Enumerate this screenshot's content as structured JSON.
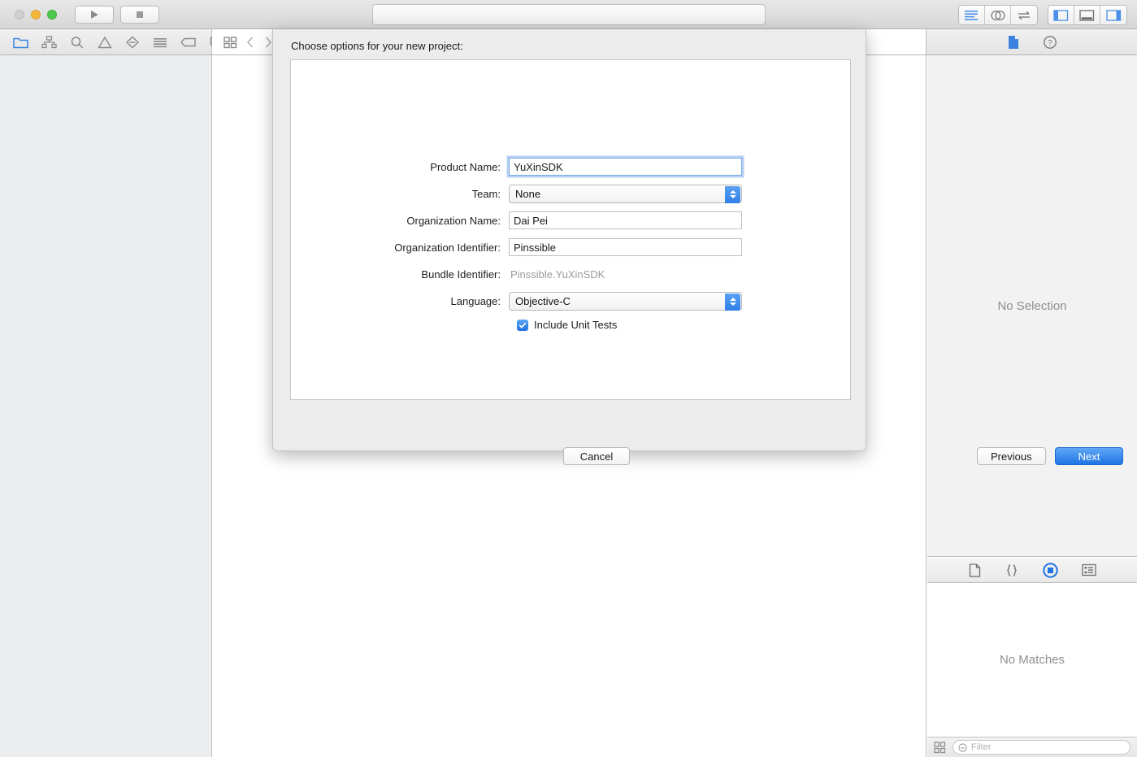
{
  "titlebar": {
    "window_controls": [
      "close",
      "minimize",
      "zoom"
    ],
    "run_label": "run-icon",
    "stop_label": "stop-icon",
    "status_text": "",
    "editor_modes": [
      "standard-editor-icon",
      "assistant-editor-icon",
      "version-editor-icon"
    ],
    "view_toggles": [
      "toggle-navigator-icon",
      "toggle-debug-area-icon",
      "toggle-utilities-icon"
    ]
  },
  "toolbar2": {
    "navigator_icons": [
      "project-navigator-icon",
      "symbol-navigator-icon",
      "find-navigator-icon",
      "issue-navigator-icon",
      "test-navigator-icon",
      "debug-navigator-icon",
      "breakpoint-navigator-icon",
      "report-navigator-icon"
    ],
    "jump_bar_icons": [
      "related-items-icon",
      "back-chevron-icon",
      "forward-chevron-icon"
    ],
    "utility_icons": [
      "file-inspector-icon",
      "quick-help-icon"
    ]
  },
  "inspector": {
    "placeholder": "No Selection"
  },
  "library": {
    "tabs": [
      "file-template-library-icon",
      "code-snippet-library-icon",
      "object-library-icon",
      "media-library-icon"
    ],
    "selected_tab_index": 2,
    "placeholder": "No Matches",
    "grid_toggle": "library-grid-icon",
    "filter_placeholder": "Filter",
    "filter_value": ""
  },
  "dialog": {
    "title": "Choose options for your new project:",
    "fields": [
      {
        "label": "Product Name:",
        "value": "YuXinSDK",
        "type": "text",
        "focused": true
      },
      {
        "label": "Team:",
        "value": "None",
        "type": "popup",
        "focused": false
      },
      {
        "label": "Organization Name:",
        "value": "Dai Pei",
        "type": "text",
        "focused": false
      },
      {
        "label": "Organization Identifier:",
        "value": "Pinssible",
        "type": "text",
        "focused": false
      },
      {
        "label": "Bundle Identifier:",
        "value": "Pinssible.YuXinSDK",
        "type": "static",
        "focused": false
      },
      {
        "label": "Language:",
        "value": "Objective-C",
        "type": "popup",
        "focused": false
      }
    ],
    "checkbox": {
      "label": "Include Unit Tests",
      "checked": true
    },
    "buttons": {
      "cancel": "Cancel",
      "previous": "Previous",
      "next": "Next"
    },
    "accent_color": "#2f7fe8"
  }
}
